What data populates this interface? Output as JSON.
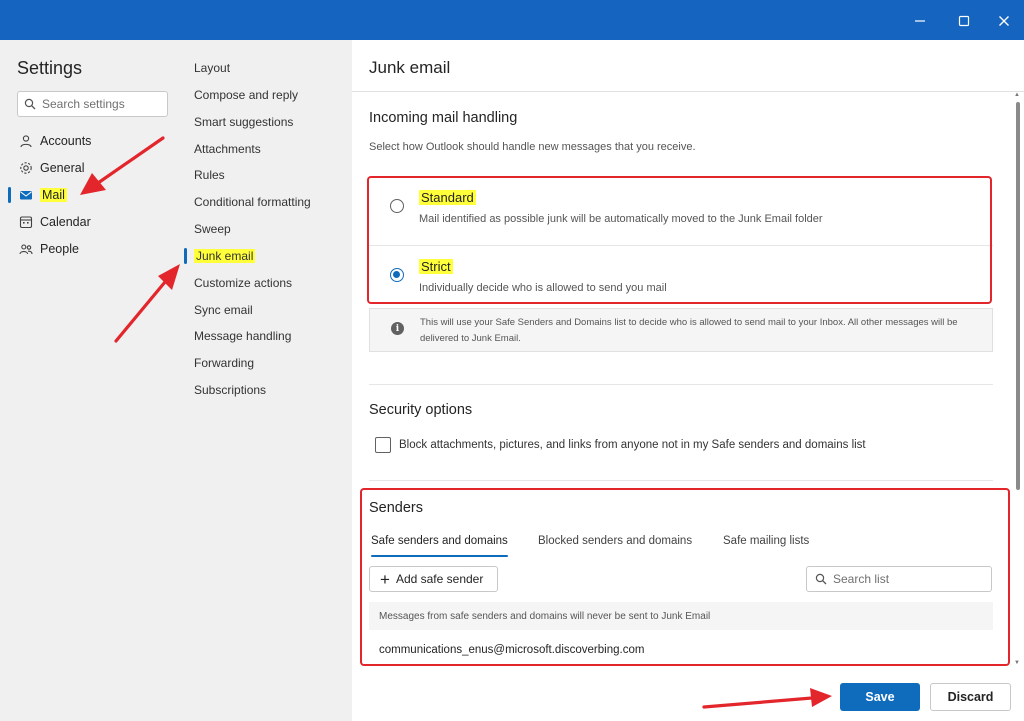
{
  "window": {
    "minimize_icon": "minimize-icon",
    "maximize_icon": "maximize-icon",
    "close_icon": "close-icon"
  },
  "settings": {
    "title": "Settings",
    "search_placeholder": "Search settings",
    "nav": [
      {
        "label": "Accounts",
        "icon": "person-icon"
      },
      {
        "label": "General",
        "icon": "gear-icon"
      },
      {
        "label": "Mail",
        "icon": "mail-icon",
        "selected": true
      },
      {
        "label": "Calendar",
        "icon": "calendar-icon"
      },
      {
        "label": "People",
        "icon": "people-icon"
      }
    ]
  },
  "mail_nav": {
    "items": [
      {
        "label": "Layout"
      },
      {
        "label": "Compose and reply"
      },
      {
        "label": "Smart suggestions"
      },
      {
        "label": "Attachments"
      },
      {
        "label": "Rules"
      },
      {
        "label": "Conditional formatting"
      },
      {
        "label": "Sweep"
      },
      {
        "label": "Junk email",
        "selected": true
      },
      {
        "label": "Customize actions"
      },
      {
        "label": "Sync email"
      },
      {
        "label": "Message handling"
      },
      {
        "label": "Forwarding"
      },
      {
        "label": "Subscriptions"
      }
    ]
  },
  "junk": {
    "title": "Junk email",
    "incoming": {
      "heading": "Incoming mail handling",
      "description": "Select how Outlook should handle new messages that you receive.",
      "options": [
        {
          "label": "Standard",
          "description": "Mail identified as possible junk will be automatically moved to the Junk Email folder",
          "checked": false
        },
        {
          "label": "Strict",
          "description": "Individually decide who is allowed to send you mail",
          "checked": true
        }
      ],
      "info": "This will use your Safe Senders and Domains list to decide who is allowed to send mail to your Inbox. All other messages will be delivered to Junk Email."
    },
    "security": {
      "heading": "Security options",
      "checkbox_label": "Block attachments, pictures, and links from anyone not in my Safe senders and domains list",
      "checked": false
    },
    "senders": {
      "heading": "Senders",
      "tabs": [
        {
          "label": "Safe senders and domains",
          "active": true
        },
        {
          "label": "Blocked senders and domains"
        },
        {
          "label": "Safe mailing lists"
        }
      ],
      "add_button": "Add safe sender",
      "search_placeholder": "Search list",
      "list_header": "Messages from safe senders and domains will never be sent to Junk Email",
      "entries": [
        "communications_enus@microsoft.discoverbing.com"
      ]
    },
    "footer": {
      "save": "Save",
      "discard": "Discard"
    }
  },
  "colors": {
    "titlebar": "#1565c0",
    "accent": "#0f6cbd",
    "highlight": "#ffff3a",
    "annotation_red": "#e3262c"
  }
}
